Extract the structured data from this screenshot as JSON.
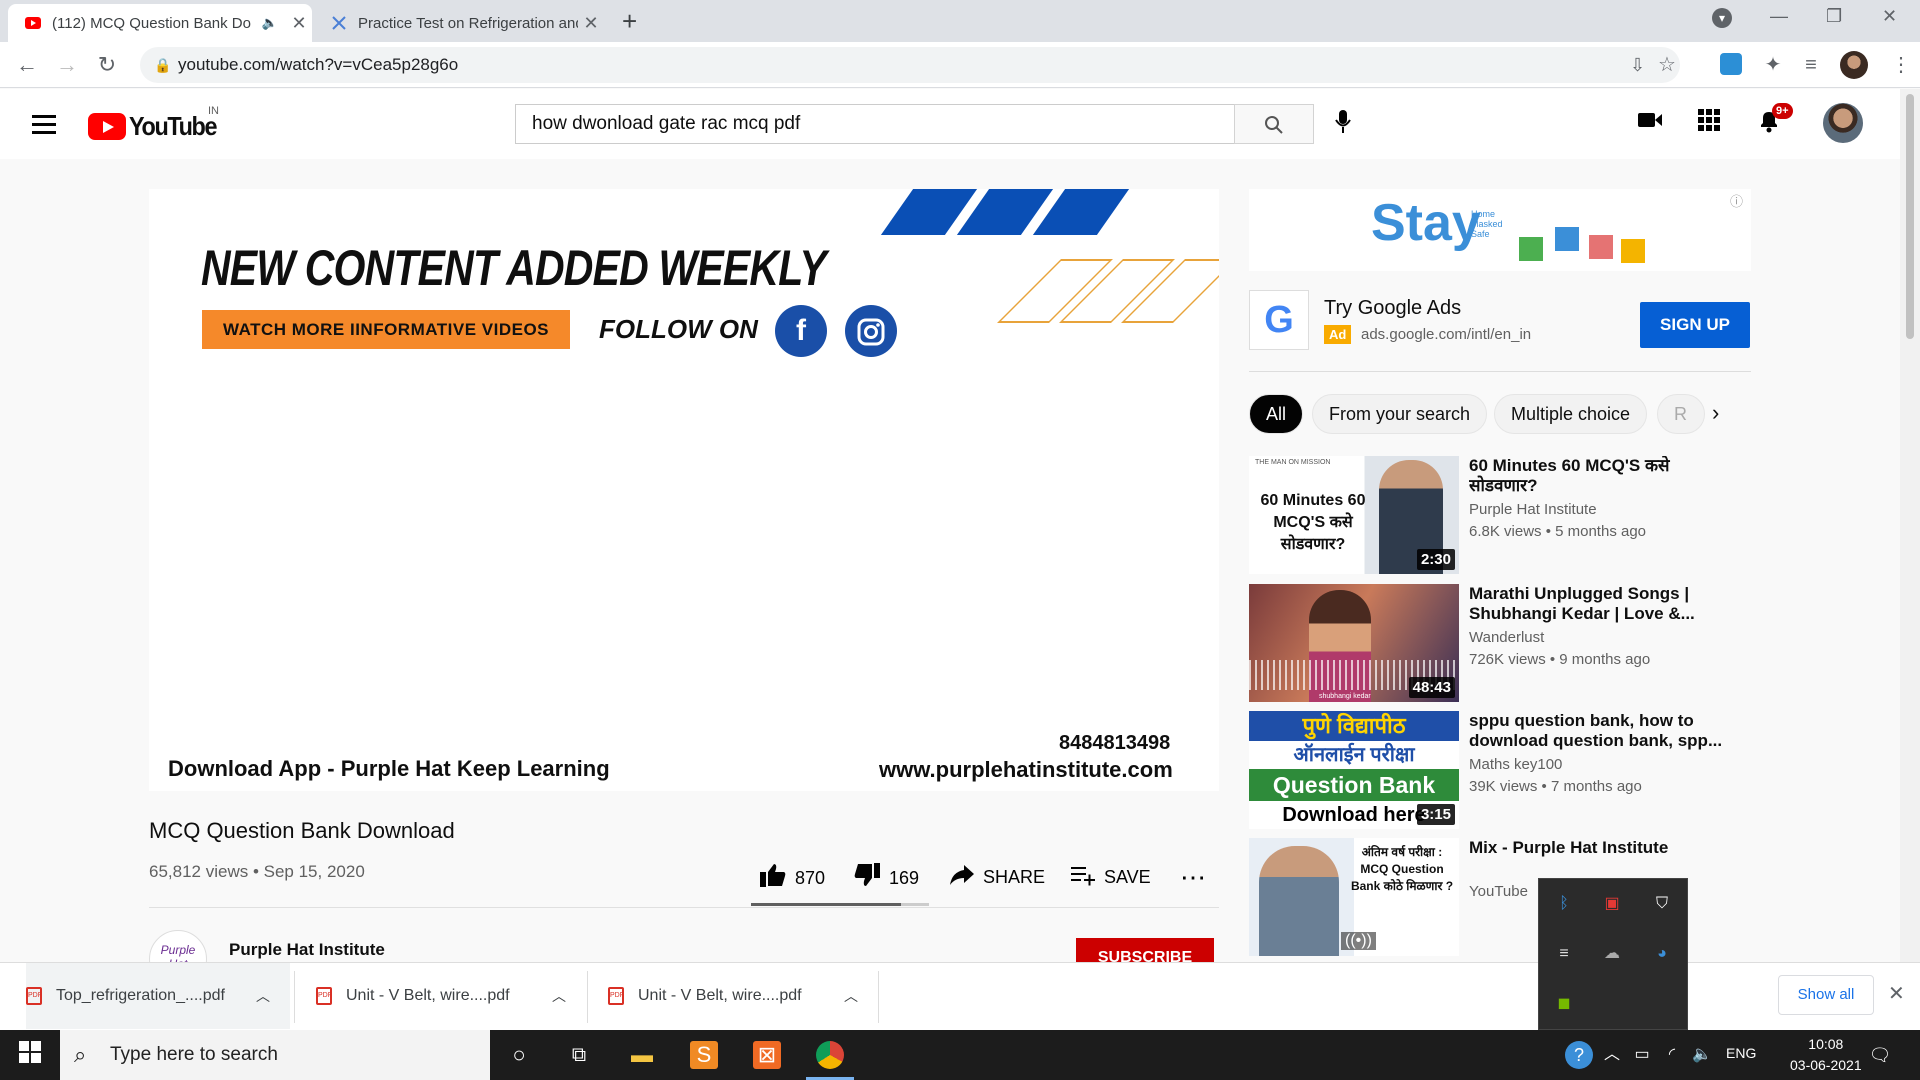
{
  "browser": {
    "tabs": [
      {
        "title": "(112) MCQ Question Bank Do",
        "active": true
      },
      {
        "title": "Practice Test on Refrigeration and",
        "active": false
      }
    ],
    "url": "youtube.com/watch?v=vCea5p28g6o"
  },
  "header": {
    "logo_text": "YouTube",
    "country": "IN",
    "search_value": "how dwonload gate rac mcq pdf",
    "notif_count": "9+"
  },
  "video": {
    "banner_headline": "NEW CONTENT ADDED WEEKLY",
    "banner_button": "WATCH MORE IINFORMATIVE VIDEOS",
    "banner_follow": "FOLLOW ON",
    "banner_app": "Download App - Purple Hat Keep Learning",
    "banner_phone": "8484813498",
    "banner_url": "www.purplehatinstitute.com",
    "title": "MCQ Question Bank Download",
    "meta": "65,812 views • Sep 15, 2020",
    "likes": "870",
    "dislikes": "169",
    "share": "SHARE",
    "save": "SAVE",
    "channel": "Purple Hat Institute",
    "subscribe": "SUBSCRIBE",
    "sentiment_like_fraction": 0.84
  },
  "ad": {
    "banner_word": "Stay",
    "banner_small": "Home Masked Safe",
    "title": "Try Google Ads",
    "tag": "Ad",
    "url": "ads.google.com/intl/en_in",
    "cta": "SIGN UP"
  },
  "chips": [
    "All",
    "From your search",
    "Multiple choice",
    "R"
  ],
  "recommendations": [
    {
      "title": "60 Minutes 60 MCQ'S कसे सोडवणार?",
      "channel": "Purple Hat Institute",
      "meta": "6.8K views • 5 months ago",
      "duration": "2:30",
      "thumb_top": "THE MAN ON MISSION",
      "thumb_text": "60 Minutes 60 MCQ'S कसे सोडवणार?"
    },
    {
      "title": "Marathi Unplugged Songs | Shubhangi Kedar | Love &...",
      "channel": "Wanderlust",
      "meta": "726K views • 9 months ago",
      "duration": "48:43",
      "thumb_text": "shubhangi kedar"
    },
    {
      "title": "sppu question bank, how to download question bank, spp...",
      "channel": "Maths key100",
      "meta": "39K views • 7 months ago",
      "duration": "3:15",
      "thumb_l1": "पुणे विद्यापीठ",
      "thumb_l2": "ऑनलाईन परीक्षा",
      "thumb_l3": "Question Bank",
      "thumb_l4": "Download here"
    },
    {
      "title": "Mix - Purple Hat Institute",
      "channel": "YouTube",
      "meta": "",
      "duration": "",
      "thumb_text": "अंतिम वर्ष परीक्षा : MCQ Question Bank कोठे मिळणार ?"
    }
  ],
  "downloads": [
    {
      "name": "Top_refrigeration_....pdf"
    },
    {
      "name": "Unit - V Belt,  wire....pdf"
    },
    {
      "name": "Unit - V Belt,  wire....pdf"
    }
  ],
  "download_show_all": "Show all",
  "taskbar": {
    "search_placeholder": "Type here to search",
    "lang": "ENG",
    "time": "10:08",
    "date": "03-06-2021"
  },
  "colors": {
    "youtube_red": "#ff0000",
    "subscribe_red": "#cc0000",
    "signup_blue": "#065fd4"
  }
}
